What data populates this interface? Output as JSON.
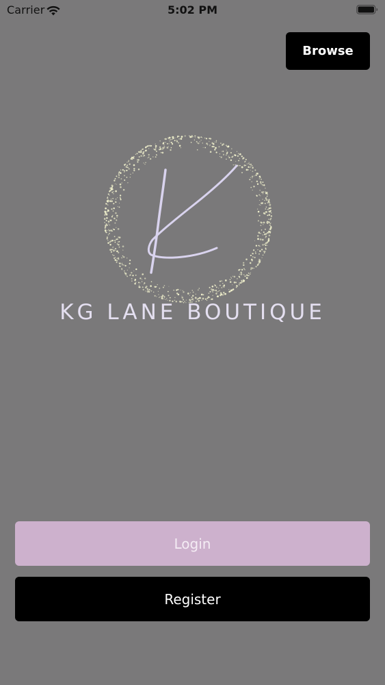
{
  "status_bar": {
    "carrier": "Carrier",
    "time": "5:02 PM"
  },
  "header": {
    "browse_label": "Browse"
  },
  "logo": {
    "brand_name": "KG LANE BOUTIQUE",
    "monogram_color": "#d9d3ee",
    "speckle_color": "#f0f0cc"
  },
  "actions": {
    "login_label": "Login",
    "register_label": "Register"
  },
  "colors": {
    "background": "#7a797a",
    "login_button": "#cdb1cd",
    "register_button": "#000000",
    "browse_button": "#000000"
  }
}
